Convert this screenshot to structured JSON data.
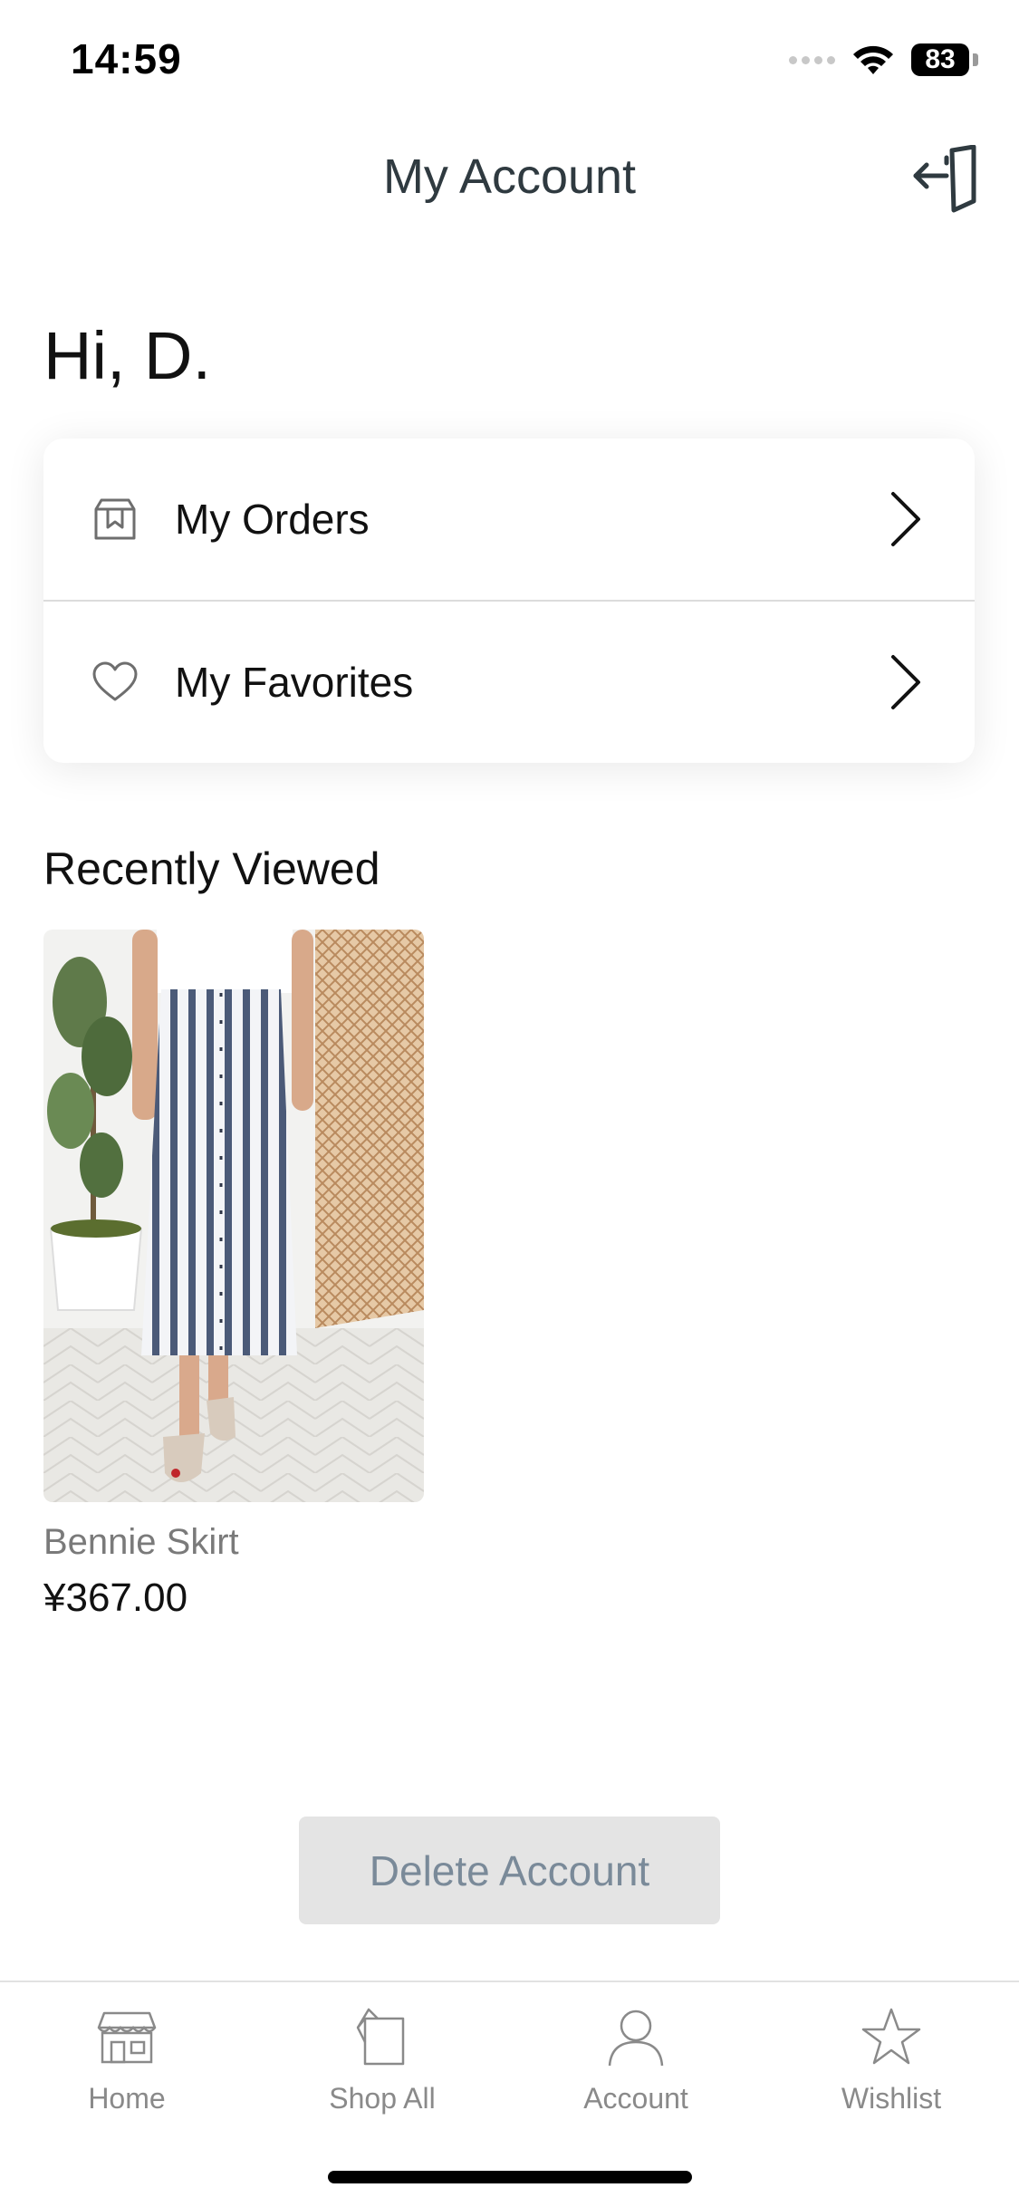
{
  "status_bar": {
    "time": "14:59",
    "battery": "83"
  },
  "header": {
    "title": "My Account",
    "logout_icon": "logout-icon"
  },
  "greeting": "Hi,  D.",
  "menu": {
    "items": [
      {
        "label": "My Orders",
        "icon": "orders-box-icon"
      },
      {
        "label": "My Favorites",
        "icon": "heart-icon"
      }
    ]
  },
  "recently_viewed": {
    "title": "Recently Viewed",
    "products": [
      {
        "name": "Bennie Skirt",
        "price": "¥367.00"
      }
    ]
  },
  "actions": {
    "delete_account": "Delete Account"
  },
  "tab_bar": {
    "tabs": [
      {
        "label": "Home",
        "icon": "home-store-icon"
      },
      {
        "label": "Shop All",
        "icon": "shop-bag-icon"
      },
      {
        "label": "Account",
        "icon": "user-icon"
      },
      {
        "label": "Wishlist",
        "icon": "star-icon"
      }
    ]
  },
  "colors": {
    "title_text": "#2f3a40",
    "muted_text": "#8a8a8a",
    "delete_bg": "#e4e4e4",
    "delete_text": "#7a8a99"
  }
}
